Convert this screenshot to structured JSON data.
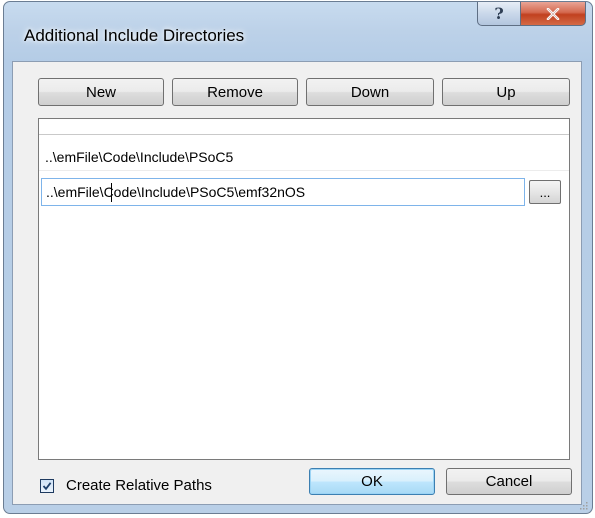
{
  "window": {
    "title": "Additional Include Directories",
    "help_glyph": "?",
    "close_glyph": "x"
  },
  "toolbar": {
    "new_label": "New",
    "remove_label": "Remove",
    "down_label": "Down",
    "up_label": "Up"
  },
  "list": {
    "items": [
      {
        "text": "..\\emFile\\Code\\Include\\PSoC5"
      }
    ],
    "editing_value": "..\\emFile\\Code\\Include\\PSoC5\\emf32nOS",
    "browse_label": "..."
  },
  "footer": {
    "create_relative_label": "Create Relative Paths",
    "create_relative_checked": true,
    "ok_label": "OK",
    "cancel_label": "Cancel"
  },
  "colors": {
    "title_bar": "#bcd1e8",
    "close_button": "#c1401f",
    "default_button": "#3c7fb1",
    "client_background": "#f0f0f0"
  }
}
